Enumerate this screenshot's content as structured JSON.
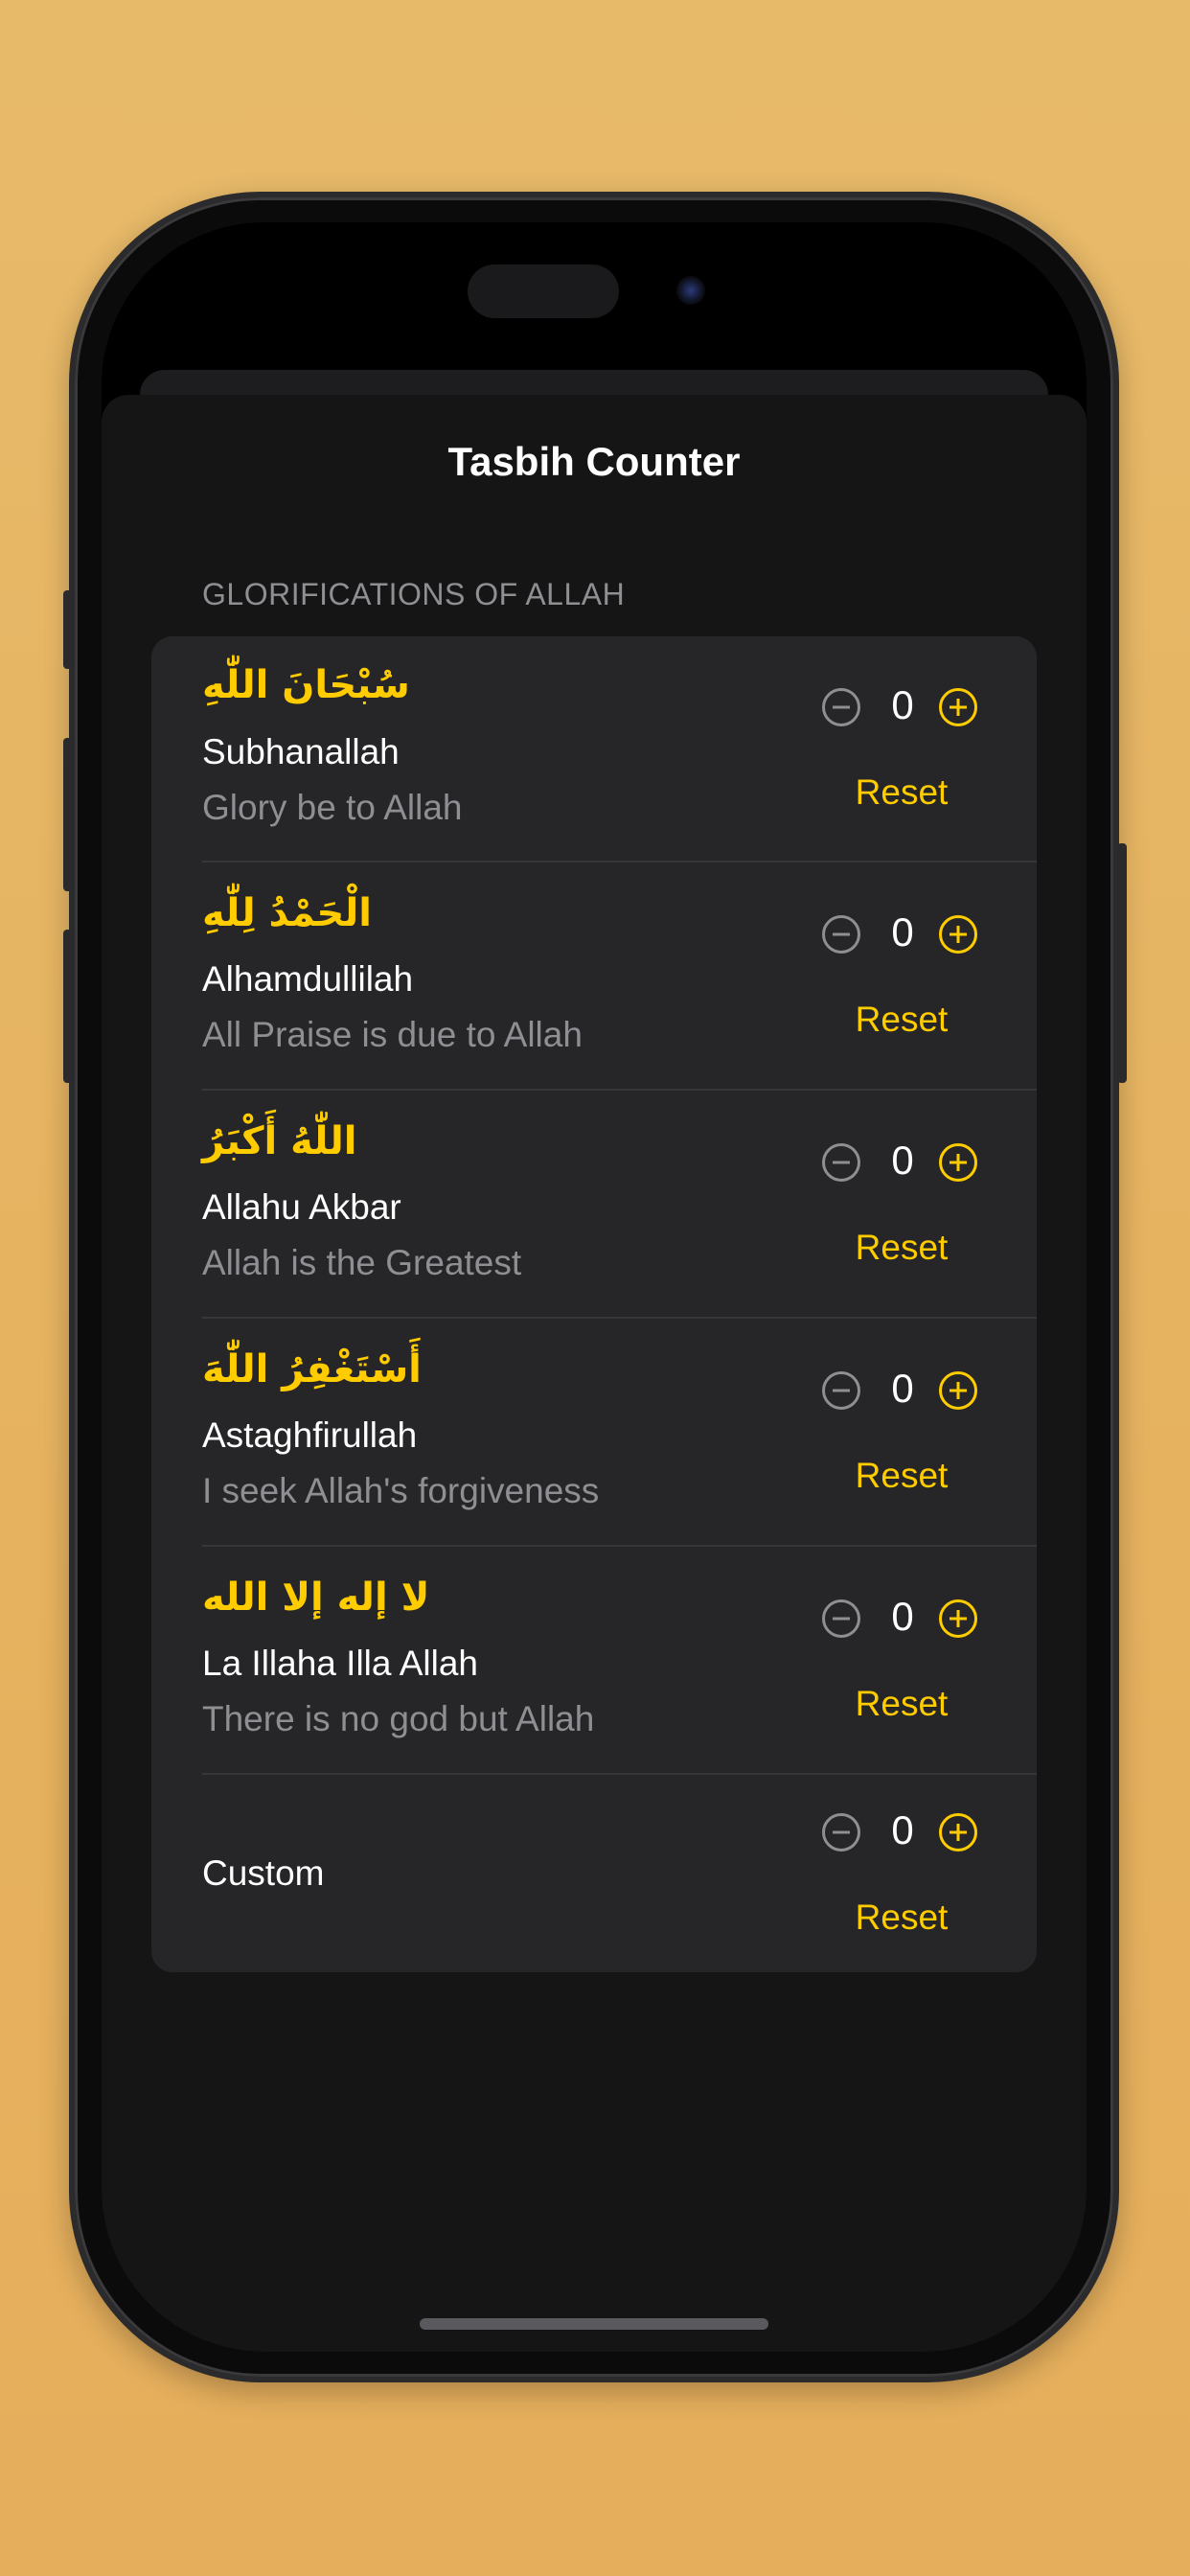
{
  "app": {
    "title": "Tasbih Counter"
  },
  "section": {
    "header": "GLORIFICATIONS OF ALLAH"
  },
  "items": [
    {
      "arabic": "سُبْحَانَ اللّٰهِ",
      "name": "Subhanallah",
      "meaning": "Glory be to Allah",
      "count": "0",
      "reset_label": "Reset"
    },
    {
      "arabic": "الْحَمْدُ لِلّٰهِ",
      "name": "Alhamdullilah",
      "meaning": "All Praise is due to Allah",
      "count": "0",
      "reset_label": "Reset"
    },
    {
      "arabic": "اللّٰهُ أَكْبَرُ",
      "name": "Allahu Akbar",
      "meaning": "Allah is the Greatest",
      "count": "0",
      "reset_label": "Reset"
    },
    {
      "arabic": "أَسْتَغْفِرُ اللّٰهَ",
      "name": "Astaghfirullah",
      "meaning": "I seek Allah's forgiveness",
      "count": "0",
      "reset_label": "Reset"
    },
    {
      "arabic": "لا إله إلا الله",
      "name": "La Illaha Illa Allah",
      "meaning": "There is no god but Allah",
      "count": "0",
      "reset_label": "Reset"
    }
  ],
  "custom": {
    "name": "Custom",
    "count": "0",
    "reset_label": "Reset"
  },
  "colors": {
    "accent": "#ffcc00",
    "background": "#e7ba6a",
    "sheet": "#151516",
    "card": "#262628",
    "secondary_text": "#8e8e93"
  },
  "icons": {
    "decrement": "minus-circle-icon",
    "increment": "plus-circle-icon"
  }
}
